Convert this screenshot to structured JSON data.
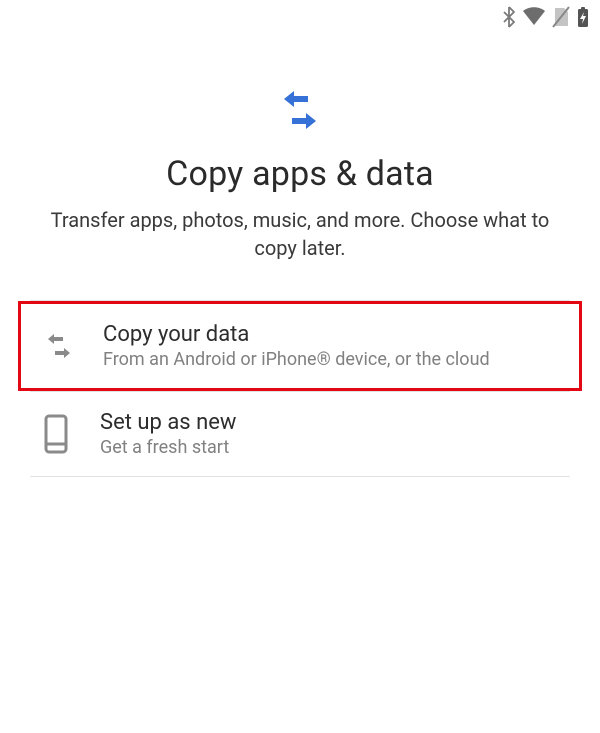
{
  "status_bar": {},
  "header": {
    "title": "Copy apps & data",
    "subtitle": "Transfer apps, photos, music, and more. Choose what to copy later."
  },
  "options": [
    {
      "id": "copy-data",
      "title": "Copy your data",
      "description": "From an Android or iPhone® device, or the cloud",
      "highlighted": true
    },
    {
      "id": "setup-new",
      "title": "Set up as new",
      "description": "Get a fresh start",
      "highlighted": false
    }
  ]
}
